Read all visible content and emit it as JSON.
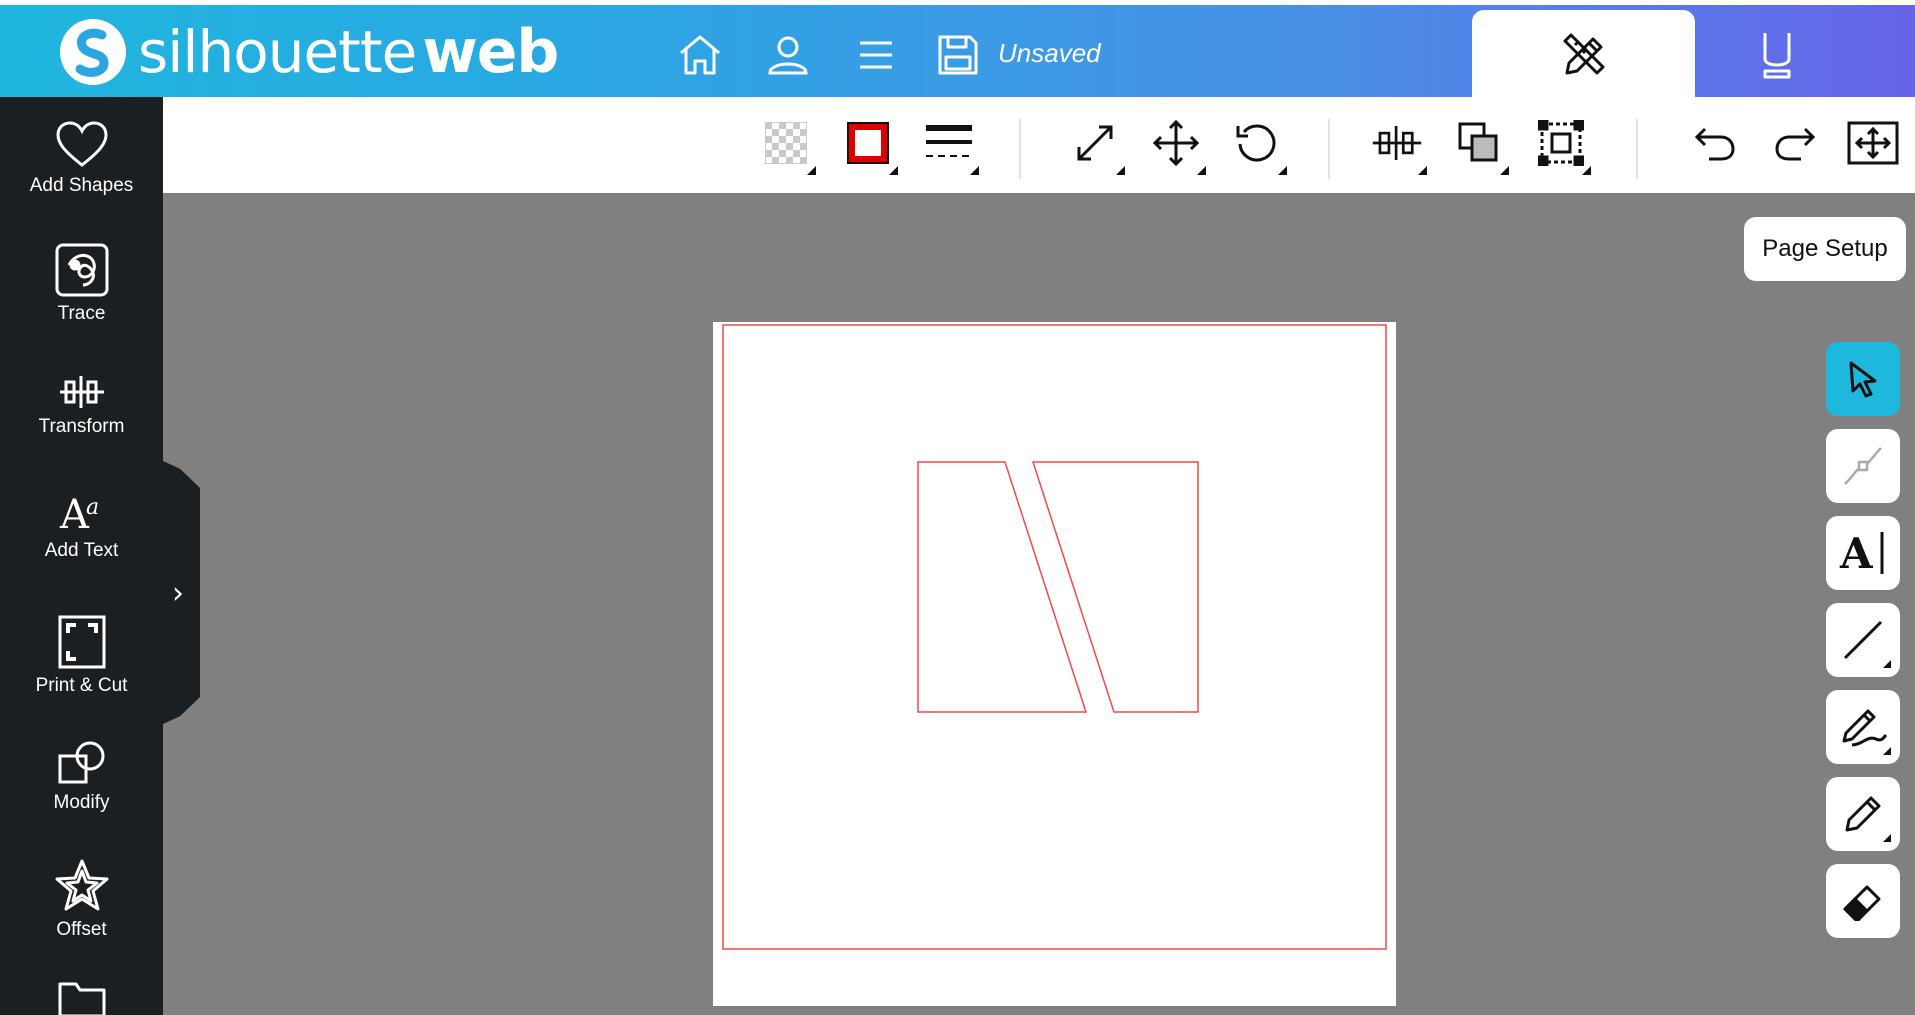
{
  "header": {
    "logo_light": "silhouette",
    "logo_bold": "web",
    "save_status": "Unsaved",
    "icons": [
      "home-icon",
      "user-icon",
      "menu-icon",
      "save-icon"
    ],
    "tab_design_icon": "pencil-ruler-icon",
    "tab_send_icon": "cutter-blade-icon"
  },
  "toolbar": {
    "icons": [
      "fill-transparency-icon",
      "stroke-color-icon",
      "line-style-icon",
      "scale-icon",
      "move-icon",
      "rotate-icon",
      "transform-icon",
      "arrange-icon",
      "group-icon",
      "undo-icon",
      "redo-icon",
      "fit-page-icon"
    ],
    "stroke_color": "#e00000"
  },
  "sidebar": {
    "items": [
      {
        "label": "Add Shapes",
        "icon": "heart-icon"
      },
      {
        "label": "Trace",
        "icon": "trace-icon"
      },
      {
        "label": "Transform",
        "icon": "transform-icon"
      },
      {
        "label": "Add Text",
        "icon": "text-icon"
      },
      {
        "label": "Print & Cut",
        "icon": "print-cut-icon"
      },
      {
        "label": "Modify",
        "icon": "modify-icon"
      },
      {
        "label": "Offset",
        "icon": "star-icon"
      },
      {
        "label": "",
        "icon": "folder-icon"
      }
    ]
  },
  "page_setup": {
    "label": "Page Setup"
  },
  "right_tools": {
    "items": [
      "select-icon",
      "node-edit-icon",
      "text-tool-icon",
      "line-tool-icon",
      "draw-tool-icon",
      "pencil-tool-icon",
      "eraser-icon"
    ],
    "active_color": "#1eb8dc"
  },
  "canvas": {
    "mat_color": "#ffffff",
    "cut_line_color": "#ee4a4a"
  }
}
